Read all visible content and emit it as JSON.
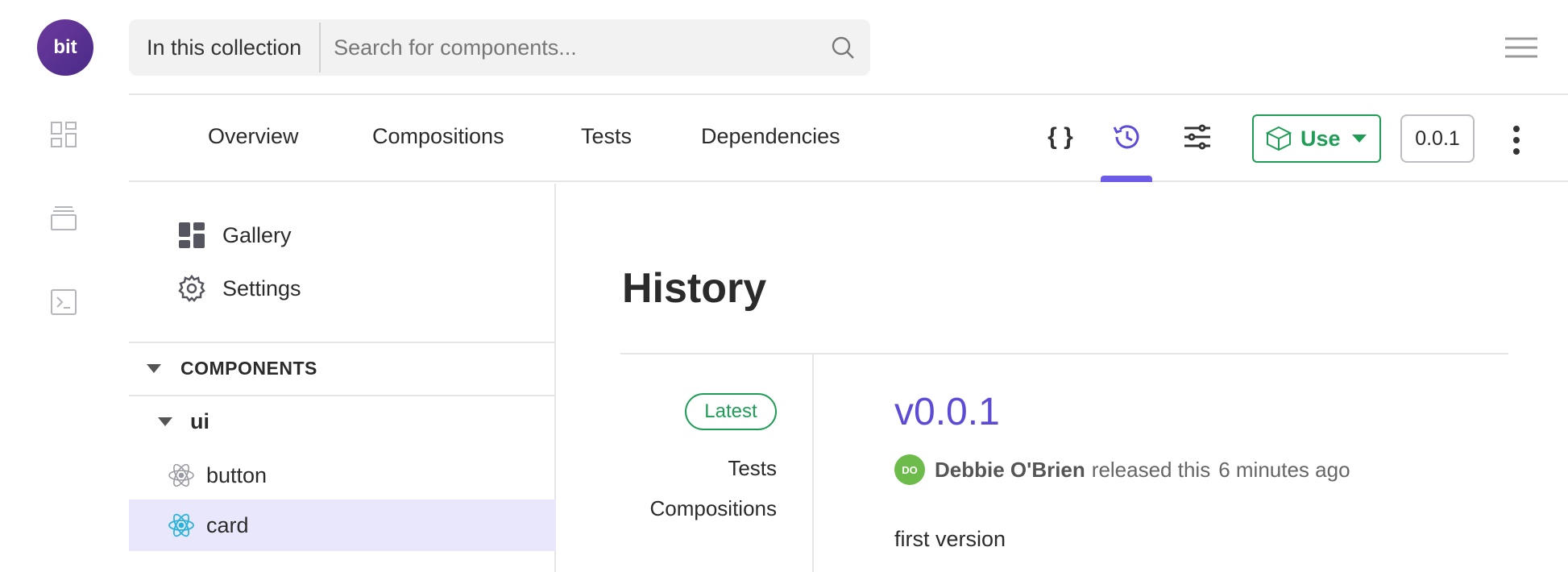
{
  "app": {
    "logo_text": "bit"
  },
  "search": {
    "scope_label": "In this collection",
    "placeholder": "Search for components..."
  },
  "tabs": [
    {
      "label": "Overview"
    },
    {
      "label": "Compositions"
    },
    {
      "label": "Tests"
    },
    {
      "label": "Dependencies"
    }
  ],
  "toolbar": {
    "code_label": "{ }",
    "use_label": "Use",
    "version_label": "0.0.1",
    "active_tool": "history-icon"
  },
  "sidebar": {
    "links": [
      {
        "label": "Gallery",
        "icon": "gallery-icon"
      },
      {
        "label": "Settings",
        "icon": "gear-icon"
      }
    ],
    "components_header": "COMPONENTS",
    "namespace": "ui",
    "items": [
      {
        "label": "button",
        "icon": "react-icon",
        "selected": false
      },
      {
        "label": "card",
        "icon": "react-icon",
        "selected": true
      }
    ]
  },
  "history": {
    "title": "History",
    "badge": "Latest",
    "links": [
      "Tests",
      "Compositions"
    ],
    "version": "v0.0.1",
    "avatar_initials": "DO",
    "author": "Debbie O'Brien",
    "action": "released this",
    "time": "6 minutes ago",
    "message": "first version"
  },
  "colors": {
    "accent": "#5b4bd6",
    "use_green": "#1f9d57",
    "selected_bg": "#e9e7fb",
    "avatar_green": "#6dbb4a"
  }
}
